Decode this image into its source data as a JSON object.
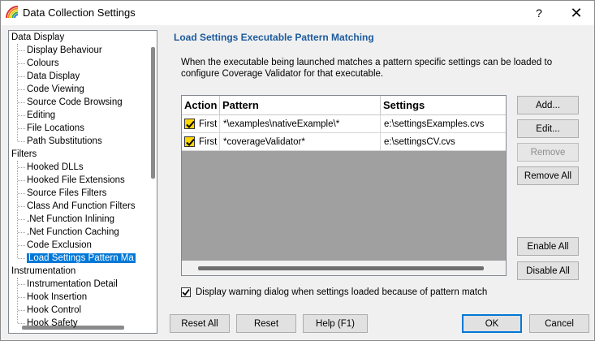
{
  "window": {
    "title": "Data Collection Settings",
    "help_glyph": "?",
    "close_glyph": "✕"
  },
  "tree": {
    "items": [
      {
        "label": "Data Display",
        "level": 0
      },
      {
        "label": "Display Behaviour",
        "level": 1
      },
      {
        "label": "Colours",
        "level": 1
      },
      {
        "label": "Data Display",
        "level": 1
      },
      {
        "label": "Code Viewing",
        "level": 1
      },
      {
        "label": "Source Code Browsing",
        "level": 1
      },
      {
        "label": "Editing",
        "level": 1
      },
      {
        "label": "File Locations",
        "level": 1
      },
      {
        "label": "Path Substitutions",
        "level": 1
      },
      {
        "label": "Filters",
        "level": 0
      },
      {
        "label": "Hooked DLLs",
        "level": 1
      },
      {
        "label": "Hooked File Extensions",
        "level": 1
      },
      {
        "label": "Source Files Filters",
        "level": 1
      },
      {
        "label": "Class And Function Filters",
        "level": 1
      },
      {
        "label": ".Net Function Inlining",
        "level": 1
      },
      {
        "label": ".Net Function Caching",
        "level": 1
      },
      {
        "label": "Code Exclusion",
        "level": 1
      },
      {
        "label": "Load Settings Pattern Ma",
        "level": 1,
        "selected": true
      },
      {
        "label": "Instrumentation",
        "level": 0
      },
      {
        "label": "Instrumentation Detail",
        "level": 1
      },
      {
        "label": "Hook Insertion",
        "level": 1
      },
      {
        "label": "Hook Control",
        "level": 1
      },
      {
        "label": "Hook Safety",
        "level": 1
      }
    ]
  },
  "content": {
    "title": "Load Settings Executable Pattern Matching",
    "description": "When the executable being launched matches a pattern specific settings can be loaded to configure Coverage Validator for that executable."
  },
  "grid": {
    "columns": [
      "Action",
      "Pattern",
      "Settings"
    ],
    "rows": [
      {
        "checked": true,
        "action": "First",
        "pattern": "*\\examples\\nativeExample\\*",
        "settings": "e:\\settingsExamples.cvs"
      },
      {
        "checked": true,
        "action": "First",
        "pattern": "*coverageValidator*",
        "settings": "e:\\settingsCV.cvs"
      }
    ]
  },
  "buttons": {
    "add": "Add...",
    "edit": "Edit...",
    "remove": "Remove",
    "remove_all": "Remove All",
    "enable_all": "Enable All",
    "disable_all": "Disable All",
    "reset_all": "Reset All",
    "reset": "Reset",
    "help": "Help (F1)",
    "ok": "OK",
    "cancel": "Cancel"
  },
  "warning_checkbox": {
    "checked": true,
    "label": "Display warning dialog when settings loaded because of pattern match"
  },
  "colors": {
    "accent": "#0078d7",
    "title_blue": "#1c5a9c",
    "check_yellow": "#ffd800"
  }
}
